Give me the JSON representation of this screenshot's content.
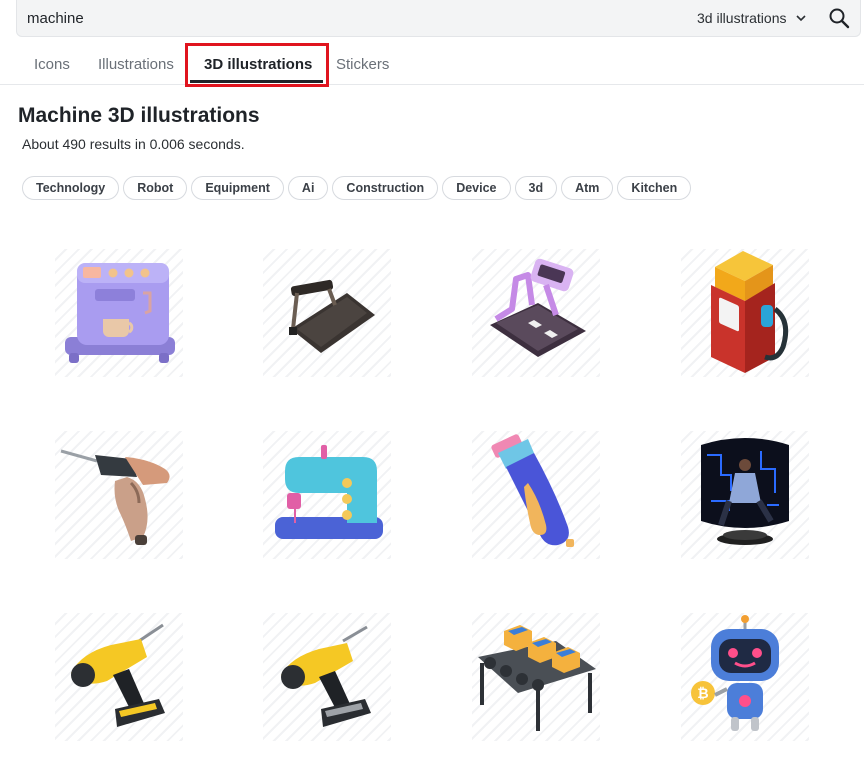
{
  "search": {
    "query": "machine",
    "scope": "3d illustrations"
  },
  "tabs": [
    {
      "label": "Icons"
    },
    {
      "label": "Illustrations"
    },
    {
      "label": "3D illustrations"
    },
    {
      "label": "Stickers"
    }
  ],
  "header": {
    "title": "Machine 3D illustrations",
    "results": "About 490 results in 0.006 seconds."
  },
  "chips": [
    "Technology",
    "Robot",
    "Equipment",
    "Ai",
    "Construction",
    "Device",
    "3d",
    "Atm",
    "Kitchen"
  ],
  "results": [
    {
      "icon": "coffee-machine-icon"
    },
    {
      "icon": "treadmill-icon"
    },
    {
      "icon": "purple-treadmill-icon"
    },
    {
      "icon": "fuel-pump-icon"
    },
    {
      "icon": "electric-drill-icon"
    },
    {
      "icon": "sewing-machine-icon"
    },
    {
      "icon": "hair-clipper-icon"
    },
    {
      "icon": "vr-man-portal-icon"
    },
    {
      "icon": "cordless-drill-icon"
    },
    {
      "icon": "cordless-drill-icon"
    },
    {
      "icon": "conveyor-belt-boxes-icon"
    },
    {
      "icon": "bitcoin-robot-icon"
    }
  ],
  "colors": {
    "highlight": "#e0141e",
    "active_tab": "#1f2328",
    "inactive_tab": "#6a7078"
  }
}
